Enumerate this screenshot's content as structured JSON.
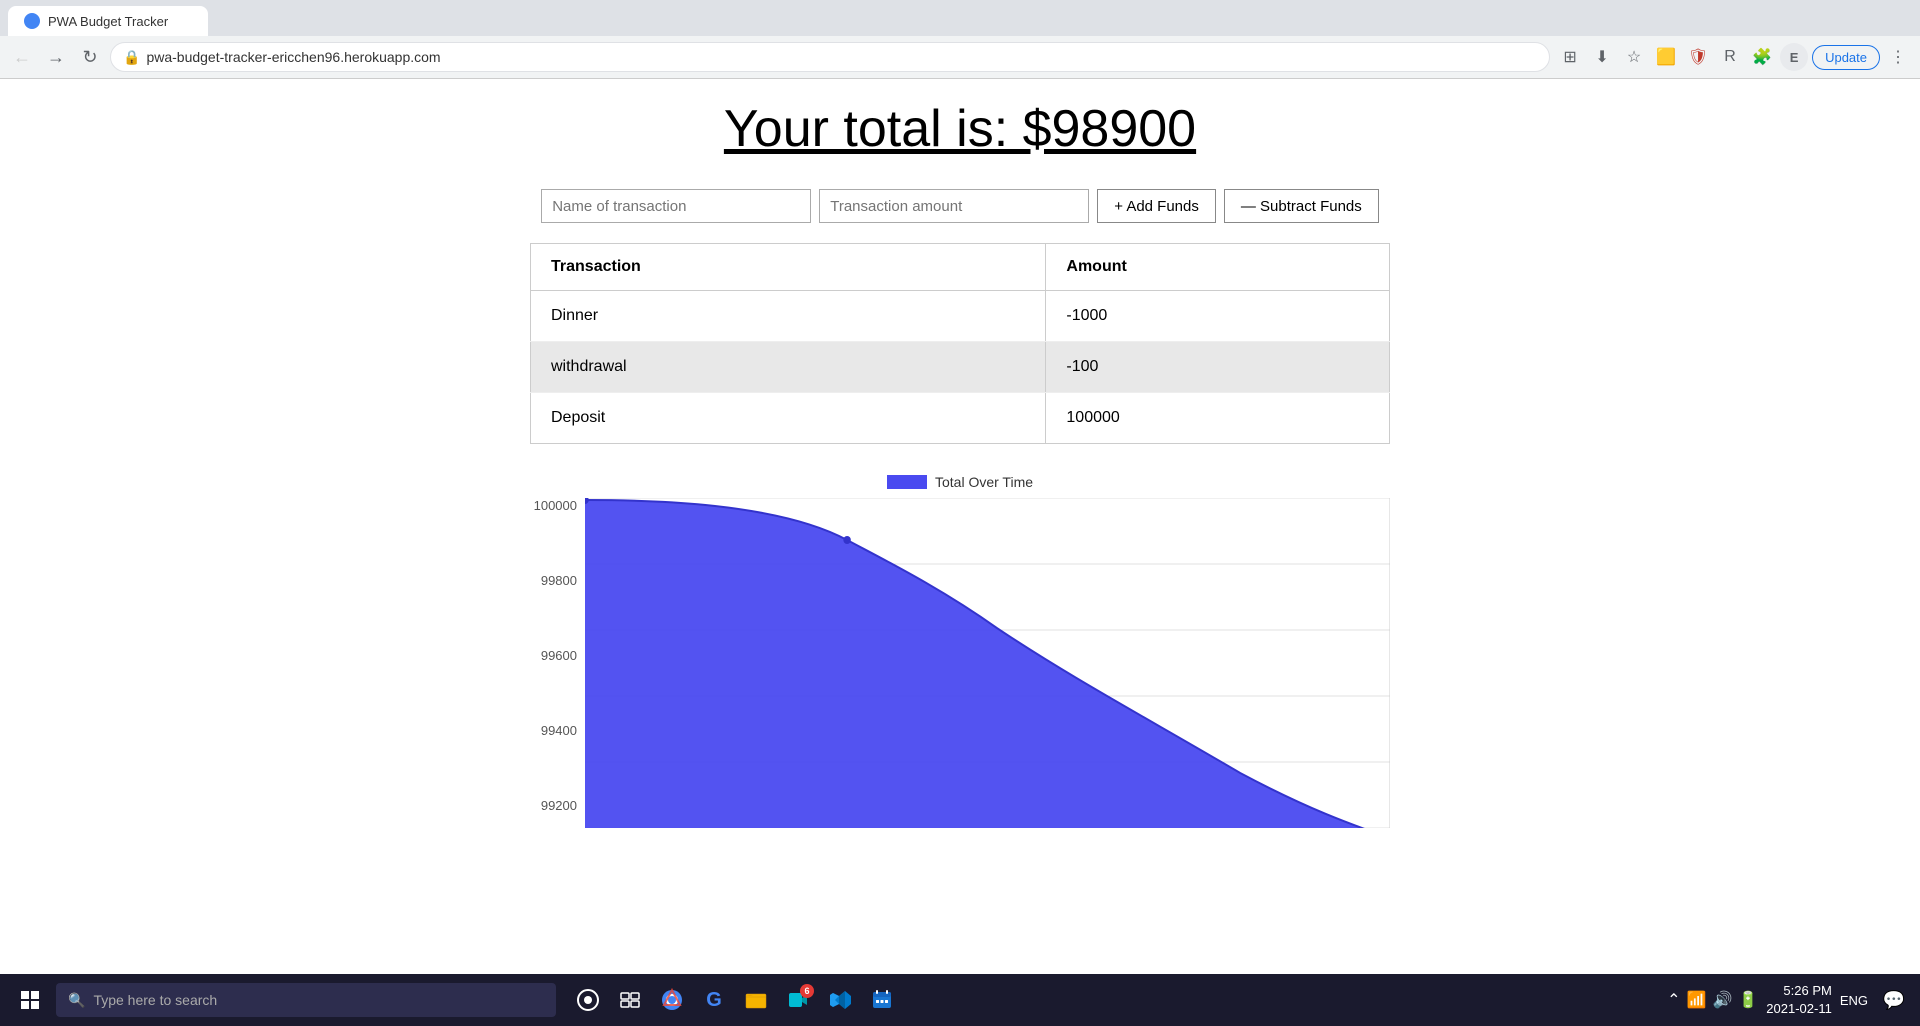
{
  "browser": {
    "tab_title": "PWA Budget Tracker",
    "url": "pwa-budget-tracker-ericchen96.herokuapp.com",
    "back_btn": "‹",
    "forward_btn": "›",
    "reload_btn": "↻",
    "update_label": "Update",
    "profile_letter": "E"
  },
  "page": {
    "title": "Your total is: $98900",
    "name_input_placeholder": "Name of transaction",
    "amount_input_placeholder": "Transaction amount",
    "add_funds_label": "+ Add Funds",
    "subtract_funds_label": "— Subtract Funds"
  },
  "table": {
    "col_transaction": "Transaction",
    "col_amount": "Amount",
    "rows": [
      {
        "name": "Dinner",
        "amount": "-1000"
      },
      {
        "name": "withdrawal",
        "amount": "-100"
      },
      {
        "name": "Deposit",
        "amount": "100000"
      }
    ]
  },
  "chart": {
    "legend_label": "Total Over Time",
    "y_labels": [
      "100000",
      "99800",
      "99600",
      "99400",
      "99200"
    ],
    "title": "chart-area"
  },
  "taskbar": {
    "search_placeholder": "Type here to search",
    "time": "5:26 PM",
    "date": "2021-02-11",
    "lang": "ENG",
    "apps": [
      {
        "icon": "○",
        "name": "cortana"
      },
      {
        "icon": "⊞",
        "name": "task-view"
      },
      {
        "icon": "chrome",
        "name": "chrome"
      },
      {
        "icon": "G",
        "name": "google-app"
      },
      {
        "icon": "📁",
        "name": "file-explorer"
      },
      {
        "icon": "M",
        "name": "meet",
        "badge": "6"
      },
      {
        "icon": "VS",
        "name": "vscode"
      },
      {
        "icon": "📅",
        "name": "calendar"
      }
    ]
  }
}
